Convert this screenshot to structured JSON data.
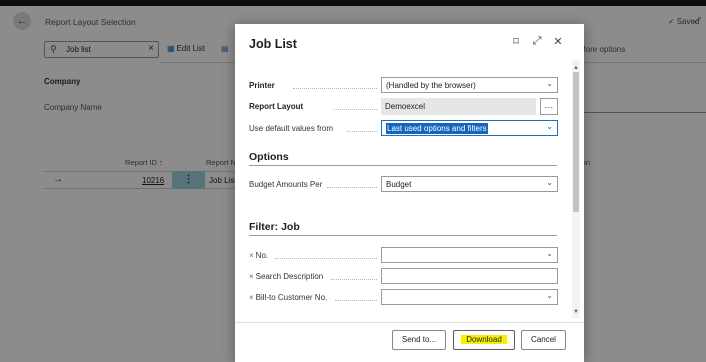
{
  "background": {
    "title": "Report Layout Selection",
    "saved_label": "Saved",
    "search_value": "Job list",
    "edit_list_label": "Edit List",
    "more_options_label": "More options",
    "company_label": "Company",
    "company_name_label": "Company Name",
    "columns": {
      "report_id": "Report ID ↑",
      "report_name": "Report Na",
      "right_col": "ion"
    },
    "row": {
      "report_id": "10216",
      "report_name": "Job List"
    }
  },
  "dialog": {
    "title": "Job List",
    "fields": {
      "printer": {
        "label": "Printer",
        "value": "(Handled by the browser)"
      },
      "report_layout": {
        "label": "Report Layout",
        "value": "Demoexcel"
      },
      "use_default": {
        "label": "Use default values from",
        "value": "Last used options and filters"
      }
    },
    "options_section": {
      "title": "Options",
      "budget_amounts_per": {
        "label": "Budget Amounts Per",
        "value": "Budget"
      }
    },
    "filter_section": {
      "title": "Filter: Job",
      "no": {
        "label": "No.",
        "value": ""
      },
      "search_description": {
        "label": "Search Description",
        "value": ""
      },
      "bill_to": {
        "label": "Bill-to Customer No.",
        "value": ""
      }
    },
    "buttons": {
      "send_to": "Send to...",
      "download": "Download",
      "cancel": "Cancel"
    }
  },
  "colors": {
    "accent": "#1565c0",
    "highlight": "#f6f000",
    "selected_row": "#9fd3df"
  }
}
